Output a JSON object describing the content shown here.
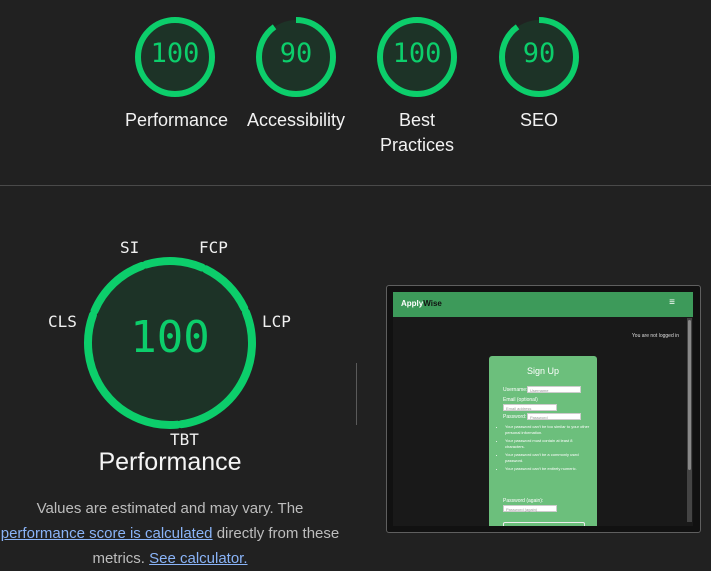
{
  "summary": {
    "gauges": [
      {
        "score": "100",
        "label": "Performance",
        "fraction": 1.0
      },
      {
        "score": "90",
        "label": "Accessibility",
        "fraction": 0.9
      },
      {
        "score": "100",
        "label": "Best Practices",
        "fraction": 1.0
      },
      {
        "score": "90",
        "label": "SEO",
        "fraction": 0.9
      }
    ]
  },
  "performance": {
    "score": "100",
    "title": "Performance",
    "metrics": {
      "si": "SI",
      "fcp": "FCP",
      "cls": "CLS",
      "lcp": "LCP",
      "tbt": "TBT"
    },
    "note_text1": "Values are estimated and may vary. The",
    "note_link1": "performance score is calculated",
    "note_text2": "directly from these metrics.",
    "note_link2": "See calculator."
  },
  "thumbnail": {
    "brand_part1": "Apply",
    "brand_part2": "Wise",
    "menu_glyph": "≡",
    "logged_in_text": "You are not logged in",
    "signup": {
      "title": "Sign Up",
      "username_label": "Username:",
      "username_placeholder": "Username",
      "email_label": "Email (optional)",
      "email_placeholder": "Email address",
      "password_label": "Password:",
      "password_placeholder": "Password",
      "rules": [
        "Your password can't be too similar to your other personal information.",
        "Your password must contain at least 8 characters.",
        "Your password can't be a commonly used password.",
        "Your password can't be entirely numeric."
      ],
      "password_again_label": "Password (again):",
      "password_again_placeholder": "Password (again)"
    }
  },
  "colors": {
    "pass": "#0cce6b",
    "gauge_fill": "#1d3327",
    "background": "#212121",
    "link": "#8ab4f8"
  }
}
